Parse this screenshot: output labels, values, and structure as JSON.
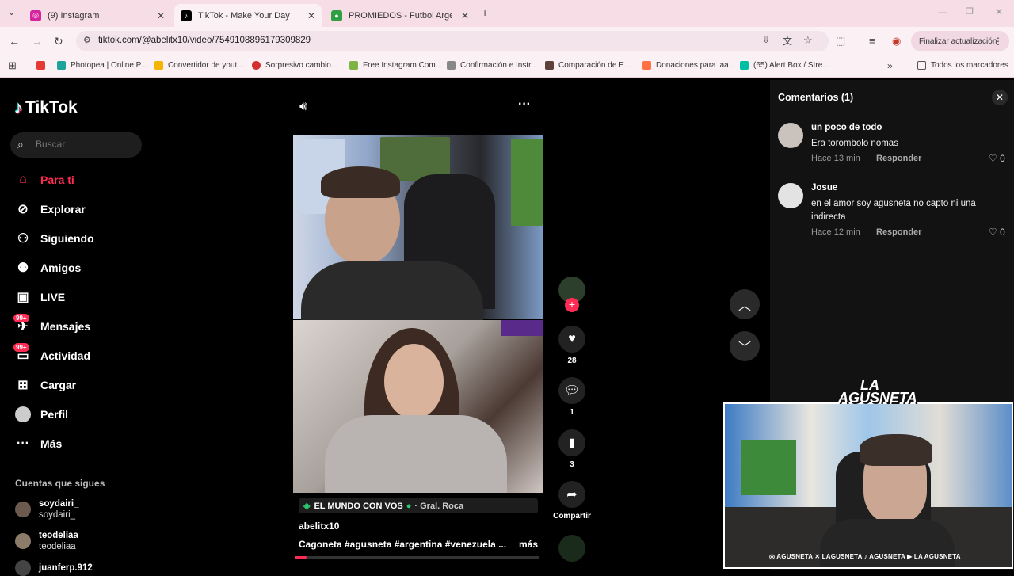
{
  "browser": {
    "tabs": [
      {
        "title": "(9) Instagram",
        "favicon_color": "#d6249f"
      },
      {
        "title": "TikTok - Make Your Day",
        "favicon_color": "#000000"
      },
      {
        "title": "PROMIEDOS - Futbol Argentino",
        "favicon_color": "#2ea043"
      }
    ],
    "url": "tiktok.com/@abelitx10/video/7549108896179309829",
    "update_button": "Finalizar actualización",
    "bookmarks": [
      "Photopea | Online P...",
      "Convertidor de yout...",
      "Sorpresivo cambio...",
      "Free Instagram Com...",
      "Confirmación e Instr...",
      "Comparación de E...",
      "Donaciones para laa...",
      "(65) Alert Box / Stre..."
    ],
    "all_bookmarks": "Todos los marcadores"
  },
  "tiktok": {
    "logo": "TikTok",
    "search_placeholder": "Buscar",
    "nav": [
      {
        "label": "Para ti",
        "icon": "home-icon"
      },
      {
        "label": "Explorar",
        "icon": "compass-icon"
      },
      {
        "label": "Siguiendo",
        "icon": "following-icon"
      },
      {
        "label": "Amigos",
        "icon": "friends-icon"
      },
      {
        "label": "LIVE",
        "icon": "live-icon"
      },
      {
        "label": "Mensajes",
        "icon": "messages-icon",
        "badge": "99+"
      },
      {
        "label": "Actividad",
        "icon": "activity-icon",
        "badge": "99+"
      },
      {
        "label": "Cargar",
        "icon": "upload-icon"
      },
      {
        "label": "Perfil",
        "icon": "profile-avatar"
      },
      {
        "label": "Más",
        "icon": "more-icon"
      }
    ],
    "following_header": "Cuentas que sigues",
    "following": [
      {
        "name": "soydairi_",
        "handle": "soydairi_"
      },
      {
        "name": "teodeliaa",
        "handle": "teodeliaa"
      },
      {
        "name": "juanferp.912",
        "handle": ""
      }
    ],
    "video": {
      "location": "EL MUNDO CON VOS",
      "city": "· Gral. Roca",
      "author": "abelitx10",
      "caption": "Cagoneta #agusneta #argentina #venezuela ...",
      "more": "más",
      "progress": 0.05
    },
    "actions": {
      "likes": "28",
      "comments": "1",
      "saves": "3",
      "share": "Compartir"
    },
    "comments_panel": {
      "title": "Comentarios (1)",
      "items": [
        {
          "user": "un poco de todo",
          "text": "Era torombolo nomas",
          "time": "Hace 13 min",
          "reply": "Responder",
          "likes": "0"
        },
        {
          "user": "Josue",
          "text": "en el amor soy agusneta no capto ni una indirecta",
          "time": "Hace 12 min",
          "reply": "Responder",
          "likes": "0"
        }
      ]
    }
  },
  "overlay": {
    "brand": "LA AGUSNETA",
    "socials": "◎ AGUSNETA  ✕ LAGUSNETA  ♪ AGUSNETA  ▶ LA AGUSNETA"
  }
}
